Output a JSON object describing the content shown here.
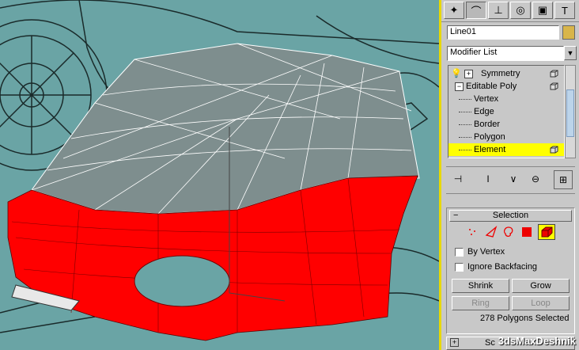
{
  "command_panel": {
    "tabs": [
      {
        "name": "create",
        "glyph": "✦"
      },
      {
        "name": "modify",
        "glyph": "⌒"
      },
      {
        "name": "hierarchy",
        "glyph": "⊥"
      },
      {
        "name": "motion",
        "glyph": "◎"
      },
      {
        "name": "display",
        "glyph": "▣"
      },
      {
        "name": "utilities",
        "glyph": "T"
      }
    ],
    "object_name": "Line01",
    "object_color": "#d8b54a",
    "modifier_list_label": "Modifier List",
    "stack": [
      {
        "label": "Symmetry",
        "prefix": "+"
      },
      {
        "label": "Editable Poly",
        "prefix": "−"
      },
      {
        "label": "Vertex"
      },
      {
        "label": "Edge"
      },
      {
        "label": "Border"
      },
      {
        "label": "Polygon"
      },
      {
        "label": "Element",
        "selected": true
      }
    ]
  },
  "selection_rollout": {
    "title": "Selection",
    "collapse_glyph": "−",
    "by_vertex_label": "By Vertex",
    "ignore_backfacing_label": "Ignore Backfacing",
    "shrink_label": "Shrink",
    "grow_label": "Grow",
    "ring_label": "Ring",
    "loop_label": "Loop",
    "status_text": "278 Polygons Selected"
  },
  "bottom_rollout_fragment": "Sc",
  "watermark": "3dsMaxDeshnik",
  "colors": {
    "selection_highlight": "#ffff00",
    "selected_faces": "#ff0000",
    "viewport_border": "#e8d800"
  }
}
